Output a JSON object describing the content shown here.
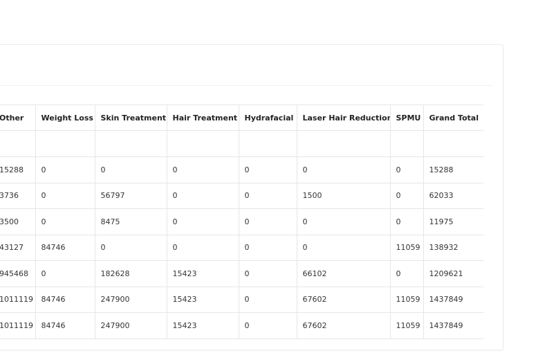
{
  "table": {
    "columns": [
      "Other",
      "Weight Loss",
      "Skin Treatment",
      "Hair Treatment",
      "Hydrafacial",
      "Laser Hair Reduction",
      "SPMU",
      "Grand Total"
    ],
    "rows": [
      [
        "",
        "",
        "",
        "",
        "",
        "",
        "",
        ""
      ],
      [
        "15288",
        "0",
        "0",
        "0",
        "0",
        "0",
        "0",
        "15288"
      ],
      [
        "3736",
        "0",
        "56797",
        "0",
        "0",
        "1500",
        "0",
        "62033"
      ],
      [
        "3500",
        "0",
        "8475",
        "0",
        "0",
        "0",
        "0",
        "11975"
      ],
      [
        "43127",
        "84746",
        "0",
        "0",
        "0",
        "0",
        "11059",
        "138932"
      ],
      [
        "945468",
        "0",
        "182628",
        "15423",
        "0",
        "66102",
        "0",
        "1209621"
      ],
      [
        "1011119",
        "84746",
        "247900",
        "15423",
        "0",
        "67602",
        "11059",
        "1437849"
      ],
      [
        "1011119",
        "84746",
        "247900",
        "15423",
        "0",
        "67602",
        "11059",
        "1437849"
      ]
    ]
  }
}
